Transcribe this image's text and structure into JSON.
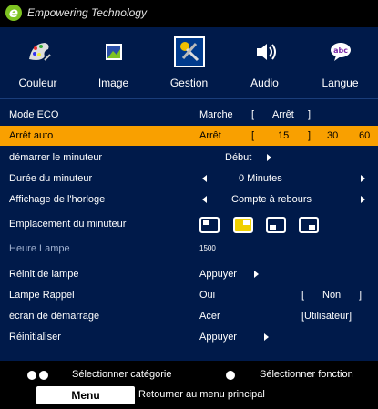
{
  "brand": {
    "tagline": "Empowering Technology"
  },
  "tabs": [
    {
      "label": "Couleur",
      "icon": "color-wheel-icon"
    },
    {
      "label": "Image",
      "icon": "image-icon"
    },
    {
      "label": "Gestion",
      "icon": "tools-icon",
      "active": true
    },
    {
      "label": "Audio",
      "icon": "speaker-icon"
    },
    {
      "label": "Langue",
      "icon": "language-abc-icon"
    }
  ],
  "rows": {
    "mode_eco": {
      "label": "Mode ECO",
      "opt_marche": "Marche",
      "bracket_open": "[",
      "opt_arret": "Arrêt",
      "bracket_close": "]"
    },
    "arret_auto": {
      "label": "Arrêt auto",
      "value": "Arrêt",
      "bracket_open": "[",
      "v15": "15",
      "bracket_close": "]",
      "v30": "30",
      "v60": "60"
    },
    "demarrer": {
      "label": "démarrer le minuteur",
      "value": "Début"
    },
    "duree": {
      "label": "Durée du minuteur",
      "value": "0 Minutes"
    },
    "affichage": {
      "label": "Affichage de l'horloge",
      "value": "Compte à rebours"
    },
    "emplacement": {
      "label": "Emplacement du minuteur"
    },
    "heure": {
      "label": "Heure Lampe",
      "value": "1500"
    },
    "reinit": {
      "label": "Réinit de lampe",
      "value": "Appuyer"
    },
    "rappel": {
      "label": "Lampe Rappel",
      "opt_oui": "Oui",
      "bracket_open": "[",
      "opt_non": "Non",
      "bracket_close": "]"
    },
    "ecran": {
      "label": "écran de démarrage",
      "opt_acer": "Acer",
      "opt_user": "[Utilisateur]"
    },
    "reinitialiser": {
      "label": "Réinitialiser",
      "value": "Appuyer"
    }
  },
  "footer": {
    "select_category": "Sélectionner catégorie",
    "select_function": "Sélectionner fonction",
    "menu_button": "Menu",
    "return_text": "Retourner au menu principal"
  },
  "colors": {
    "accent": "#f9a000",
    "menu_bg": "#001a4a",
    "selected_position": "#f0d000"
  }
}
